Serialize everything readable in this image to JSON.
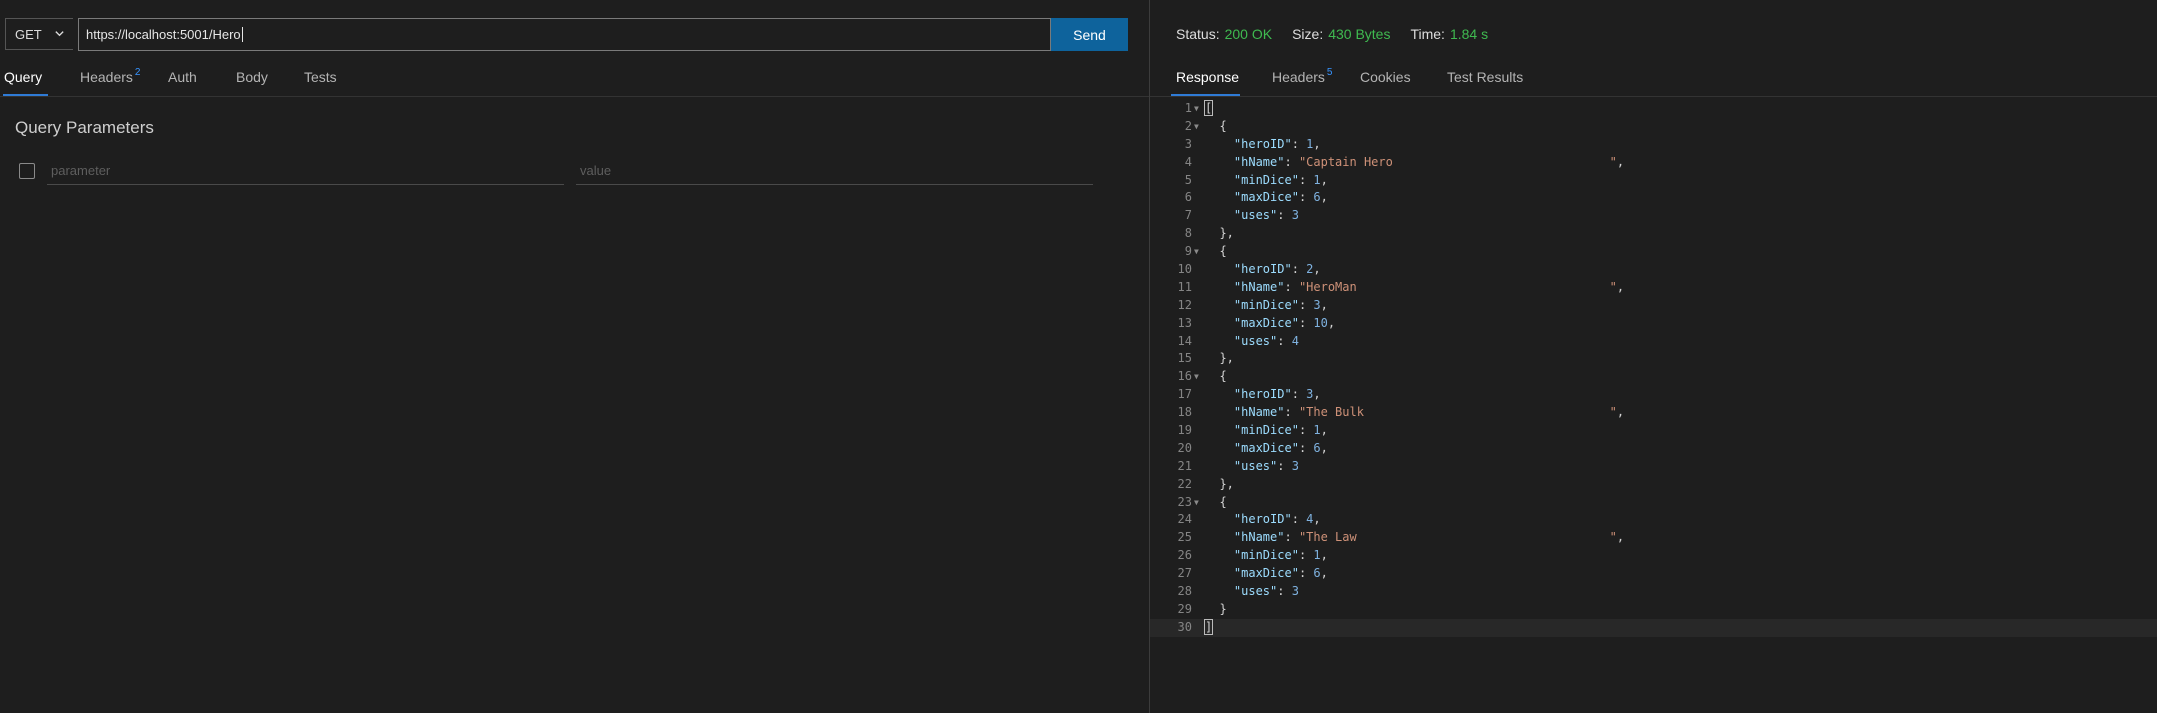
{
  "request": {
    "method": "GET",
    "url": "https://localhost:5001/Hero",
    "send_label": "Send"
  },
  "request_tabs": [
    {
      "label": "Query",
      "badge": ""
    },
    {
      "label": "Headers",
      "badge": "2"
    },
    {
      "label": "Auth",
      "badge": ""
    },
    {
      "label": "Body",
      "badge": ""
    },
    {
      "label": "Tests",
      "badge": ""
    }
  ],
  "query": {
    "title": "Query Parameters",
    "param_placeholder": "parameter",
    "value_placeholder": "value"
  },
  "response_status": {
    "status_label": "Status:",
    "status_value": "200 OK",
    "size_label": "Size:",
    "size_value": "430 Bytes",
    "time_label": "Time:",
    "time_value": "1.84 s"
  },
  "response_tabs": [
    {
      "label": "Response",
      "badge": ""
    },
    {
      "label": "Headers",
      "badge": "5"
    },
    {
      "label": "Cookies",
      "badge": ""
    },
    {
      "label": "Test Results",
      "badge": ""
    }
  ],
  "response_body": {
    "heroes": [
      {
        "heroID": 1,
        "hName": "Captain Hero",
        "minDice": 1,
        "maxDice": 6,
        "uses": 3
      },
      {
        "heroID": 2,
        "hName": "HeroMan",
        "minDice": 3,
        "maxDice": 10,
        "uses": 4
      },
      {
        "heroID": 3,
        "hName": "The Bulk",
        "minDice": 1,
        "maxDice": 6,
        "uses": 3
      },
      {
        "heroID": 4,
        "hName": "The Law",
        "minDice": 1,
        "maxDice": 6,
        "uses": 3
      }
    ]
  }
}
